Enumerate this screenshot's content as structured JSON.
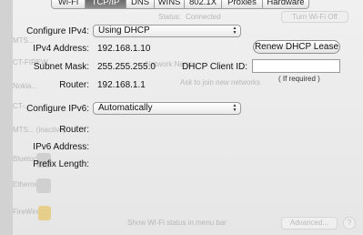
{
  "tabs": [
    {
      "label": "Wi-Fi",
      "active": false
    },
    {
      "label": "TCP/IP",
      "active": true
    },
    {
      "label": "DNS",
      "active": false
    },
    {
      "label": "WINS",
      "active": false
    },
    {
      "label": "802.1X",
      "active": false
    },
    {
      "label": "Proxies",
      "active": false
    },
    {
      "label": "Hardware",
      "active": false
    }
  ],
  "ipv4": {
    "configure_label": "Configure IPv4:",
    "configure_value": "Using DHCP",
    "address_label": "IPv4 Address:",
    "address_value": "192.168.1.10",
    "subnet_label": "Subnet Mask:",
    "subnet_value": "255.255.255.0",
    "router_label": "Router:",
    "router_value": "192.168.1.1",
    "renew_button": "Renew DHCP Lease",
    "client_id_label": "DHCP Client ID:",
    "client_id_value": "",
    "client_id_hint": "( If required )"
  },
  "ipv6": {
    "configure_label": "Configure IPv6:",
    "configure_value": "Automatically",
    "router_label": "Router:",
    "address_label": "IPv6 Address:",
    "prefix_label": "Prefix Length:"
  },
  "background": {
    "status_label": "Status:",
    "status_value": "Connected",
    "turn_off_button": "Turn Wi-Fi Off",
    "network_name_label": "Network Name:",
    "ask_join": "Ask to join new networks",
    "show_wifi_status": "Show Wi-Fi status in menu bar",
    "advanced_button": "Advanced...",
    "help_button": "?",
    "side_items": [
      "MTS...",
      "CT-FIREW...",
      "Nokia...",
      "CT-...",
      "MTS... (inactive)",
      "Bluetooth",
      "Ethernet",
      "FireWire"
    ]
  }
}
